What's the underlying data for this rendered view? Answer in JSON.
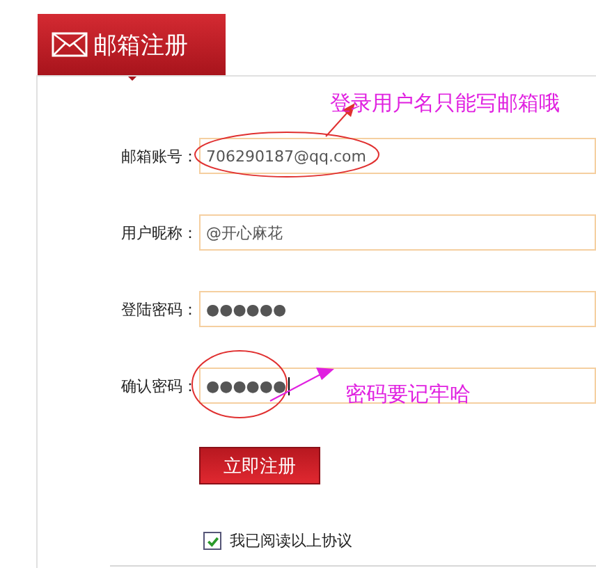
{
  "header": {
    "title": "邮箱注册"
  },
  "fields": [
    {
      "label": "邮箱账号：",
      "value": "706290187@qq.com",
      "focused": false
    },
    {
      "label": "用户昵称：",
      "value": "@开心麻花",
      "focused": false
    },
    {
      "label": "登陆密码：",
      "value": "●●●●●●",
      "focused": false
    },
    {
      "label": "确认密码：",
      "value": "●●●●●●",
      "focused": true
    }
  ],
  "annotations": [
    {
      "text": "登录用户名只能写邮箱哦"
    },
    {
      "text": "密码要记牢哈"
    }
  ],
  "submit_button": "立即注册",
  "agreement": {
    "label": "我已阅读以上协议",
    "checked": true
  }
}
